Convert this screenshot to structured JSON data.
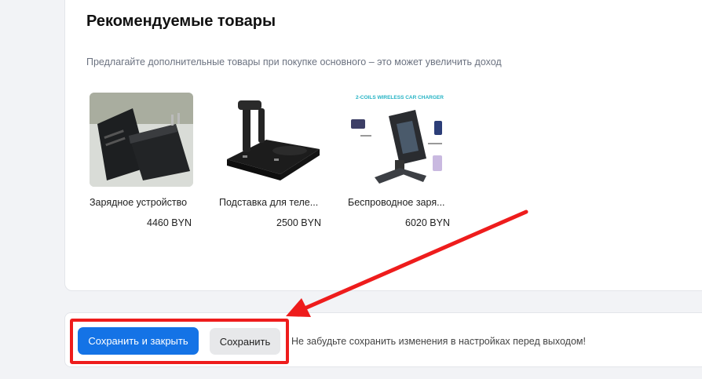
{
  "section": {
    "title": "Рекомендуемые товары",
    "subtitle": "Предлагайте дополнительные товары при покупке основного – это может увеличить доход"
  },
  "products": [
    {
      "name": "Зарядное устройство",
      "price": "4460 BYN",
      "image": "charger-adapter"
    },
    {
      "name": "Подставка для теле...",
      "price": "2500 BYN",
      "image": "charging-stand"
    },
    {
      "name": "Беспроводное заря...",
      "price": "6020 BYN",
      "image": "wireless-car-charger",
      "image_caption": "2-COILS WIRELESS CAR CHARGER"
    }
  ],
  "footer": {
    "save_close_label": "Сохранить и закрыть",
    "save_label": "Сохранить",
    "hint": "Не забудьте сохранить изменения в настройках перед выходом!"
  },
  "colors": {
    "primary": "#1473e6",
    "annotation": "#ee1c1c",
    "page_bg": "#f2f3f6"
  }
}
